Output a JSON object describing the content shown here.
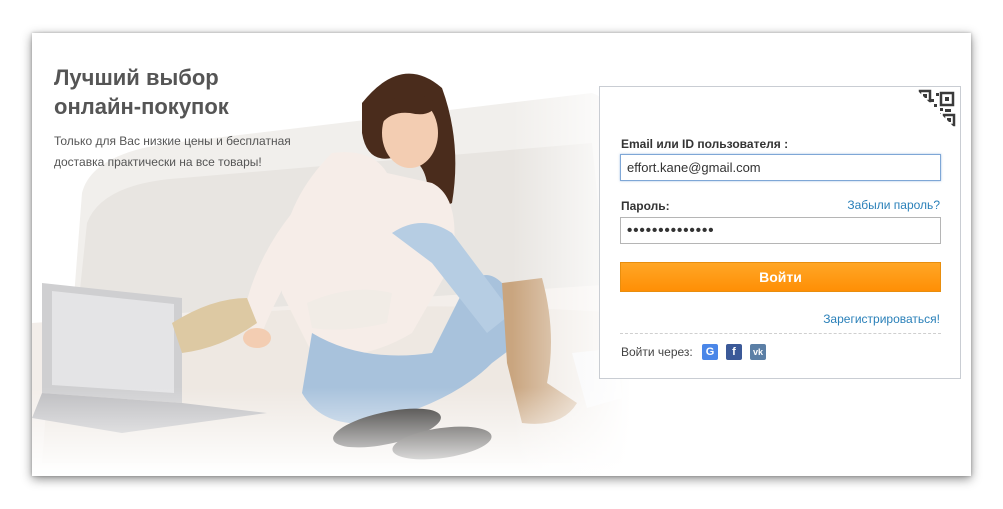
{
  "hero": {
    "headline_line1": "Лучший выбор",
    "headline_line2": "онлайн-покупок",
    "subtitle_line1": "Только для Вас низкие цены и бесплатная",
    "subtitle_line2": "доставка практически на все товары!"
  },
  "login": {
    "email_label": "Email или ID пользователя :",
    "email_value": "effort.kane@gmail.com",
    "password_label": "Пароль:",
    "forgot_link": "Забыли пароль?",
    "password_mask": "••••••••••••••",
    "submit_label": "Войти",
    "register_link": "Зарегистрироваться!",
    "social_label": "Войти через:",
    "social": [
      {
        "name": "google",
        "glyph": "G",
        "icon": "google-icon"
      },
      {
        "name": "facebook",
        "glyph": "f",
        "icon": "facebook-icon"
      },
      {
        "name": "vk",
        "glyph": "vk",
        "icon": "vk-icon"
      }
    ]
  },
  "colors": {
    "accent_orange": "#ff9a12",
    "link_blue": "#2a80b9",
    "headline_gray": "#555555"
  }
}
